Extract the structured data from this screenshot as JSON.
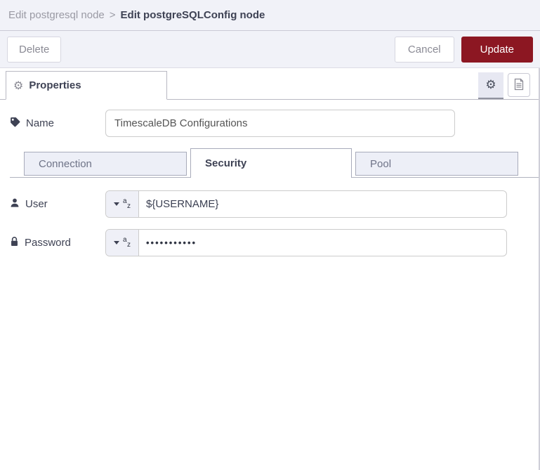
{
  "breadcrumb": {
    "parent": "Edit postgresql node",
    "separator": ">",
    "current": "Edit postgreSQLConfig node"
  },
  "toolbar": {
    "delete_label": "Delete",
    "cancel_label": "Cancel",
    "update_label": "Update"
  },
  "properties_panel": {
    "tab_label": "Properties",
    "gear_glyph": "⚙"
  },
  "fields": {
    "name": {
      "label": "Name",
      "value": "TimescaleDB Configurations"
    },
    "user": {
      "label": "User",
      "value": "${USERNAME}"
    },
    "password": {
      "label": "Password",
      "value": "•••••••••••"
    }
  },
  "string_type_icon": {
    "top": "a",
    "bottom": "z"
  },
  "tabs": [
    {
      "label": "Connection",
      "active": false
    },
    {
      "label": "Security",
      "active": true
    },
    {
      "label": "Pool",
      "active": false
    }
  ],
  "colors": {
    "header_bg": "#f1f2f8",
    "accent_red": "#8C1722",
    "dark_text": "#3e4254",
    "muted_text": "#9a9aa4",
    "inactive_tab_bg": "#edeff7",
    "typed_button_bg": "#eff0f7",
    "input_border": "#cccccc"
  }
}
